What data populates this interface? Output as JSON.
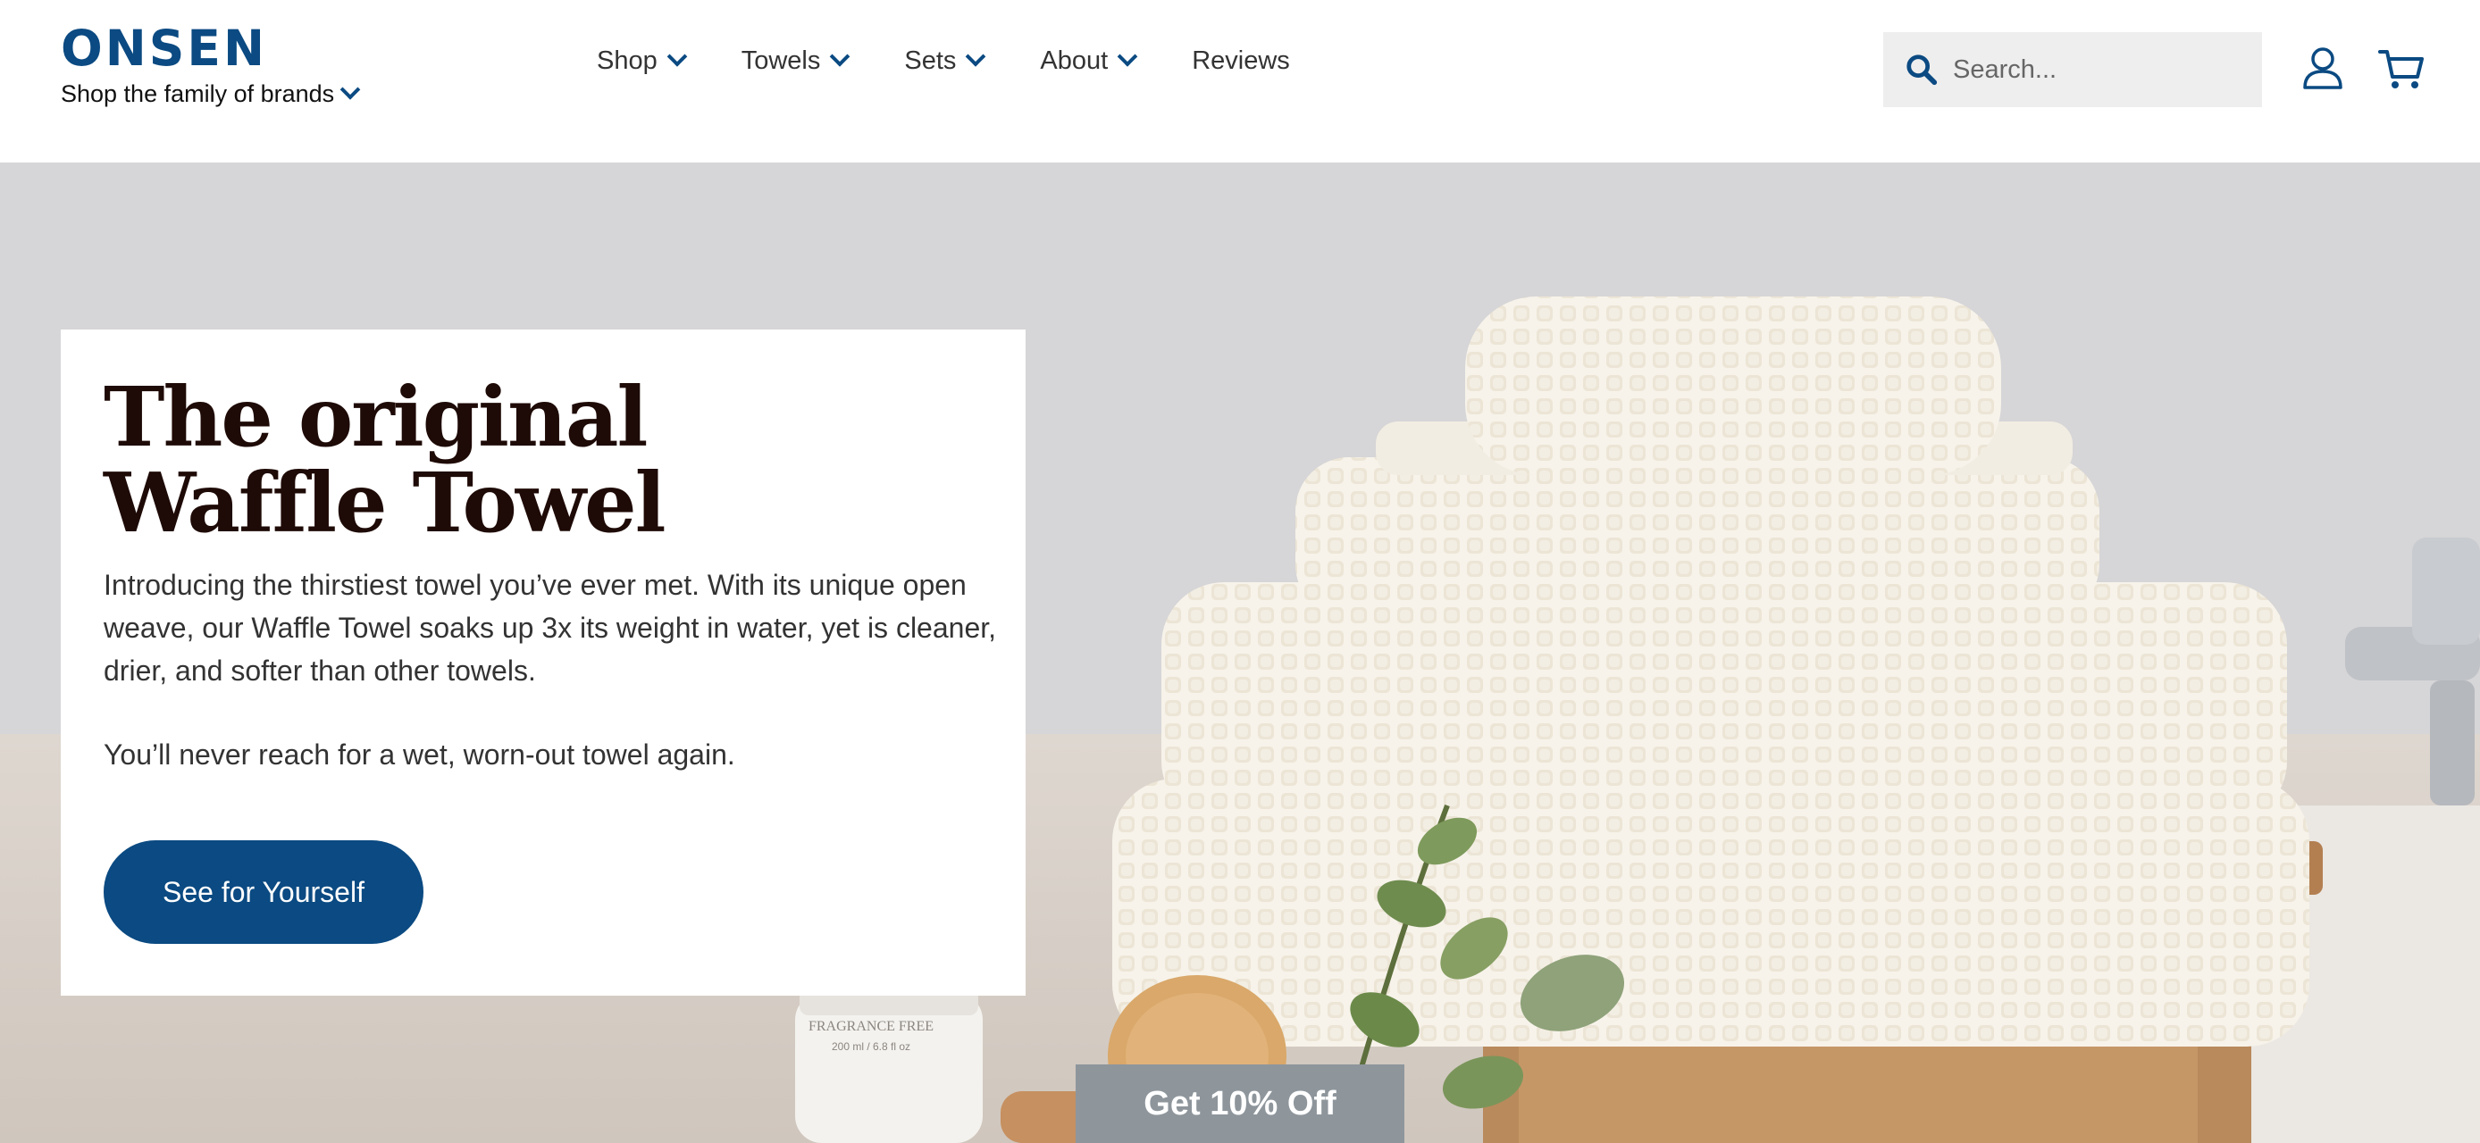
{
  "brand": {
    "logo": "ONSEN",
    "family_link": "Shop the family of brands"
  },
  "nav": {
    "items": [
      {
        "label": "Shop",
        "has_dropdown": true
      },
      {
        "label": "Towels",
        "has_dropdown": true
      },
      {
        "label": "Sets",
        "has_dropdown": true
      },
      {
        "label": "About",
        "has_dropdown": true
      },
      {
        "label": "Reviews",
        "has_dropdown": false
      }
    ]
  },
  "search": {
    "placeholder": "Search...",
    "icon": "search-icon"
  },
  "icons": {
    "account": "account-icon",
    "cart": "cart-icon"
  },
  "hero": {
    "title_line1": "The original",
    "title_line2": "Waffle Towel",
    "body": "Introducing the thirstiest towel you’ve ever met. With its unique open weave, our Waffle Towel soaks up 3x its weight in water, yet is cleaner, drier, and softer than other towels.",
    "body2": "You’ll never reach for a wet, worn-out towel again.",
    "cta_label": "See for Yourself",
    "bottle_label": "FRAGRANCE FREE",
    "bottle_size": "200 ml / 6.8 fl oz"
  },
  "promo_tab": {
    "label": "Get 10% Off"
  },
  "colors": {
    "brand_blue": "#0b4a82",
    "title_dark": "#1e0a06",
    "promo_tab_gray": "#8e969c"
  }
}
